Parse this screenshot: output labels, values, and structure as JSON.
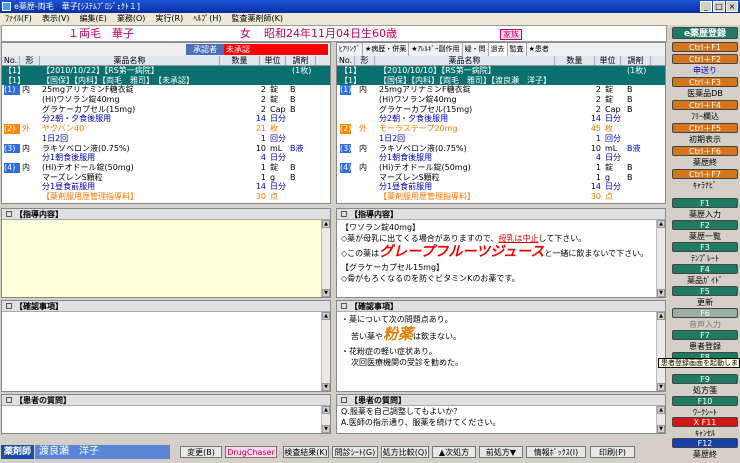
{
  "window": {
    "title": "e薬歴-両毛　華子[ｼｽﾃﾑﾌﾟﾛｼﾞｪｸﾄ１]"
  },
  "menu": [
    "ﾌｧｲﾙ(F)",
    "表示(V)",
    "編集(E)",
    "業務(O)",
    "実行(R)",
    "ﾍﾙﾌﾟ(H)",
    "監査薬剤師(K)"
  ],
  "patient": {
    "name": "１両毛　華子",
    "sex": "女",
    "birth": "昭和24年11月04日生",
    "age": "60歳",
    "badge": "家族"
  },
  "left": {
    "approver_label": "承認者",
    "approver_value": "未承認",
    "headers": [
      "No.",
      "形",
      "薬品名称",
      "数量",
      "単位",
      "調剤"
    ],
    "rows": [
      {
        "grp": true,
        "no": "【1】",
        "name": "【2010/10/22】【RS第一病院】",
        "adj": "(1枚)"
      },
      {
        "grp": true,
        "no": "【1】",
        "name": "【国保】【内科】【両毛　雅司】　【未承認】"
      },
      {
        "no": "(1)",
        "f": "内",
        "name": "25mgアリナミンF糖衣錠",
        "qty": "2",
        "unit": "錠",
        "adj": "B"
      },
      {
        "name": "(Hi)ワソラン錠40mg",
        "qty": "2",
        "unit": "錠",
        "adj": "B"
      },
      {
        "name": "グラケーカプセル(15mg)",
        "qty": "2",
        "unit": "Cap",
        "adj": "B"
      },
      {
        "name": "分2朝・夕食後服用",
        "qty": "14",
        "unit": "日分",
        "cls": "blue"
      },
      {
        "no": "(2)",
        "f": "外",
        "name": "ヤクバン40",
        "qty": "21",
        "unit": "枚",
        "cls": "orange"
      },
      {
        "name": "1日2回",
        "qty": "1",
        "unit": "回分",
        "cls": "blue"
      },
      {
        "no": "(3)",
        "f": "内",
        "name": "ラキソベロン液(0.75%)",
        "qty": "10",
        "unit": "mL",
        "adj": "B液"
      },
      {
        "name": "分1朝食後服用",
        "qty": "4",
        "unit": "日分",
        "cls": "blue"
      },
      {
        "no": "(4)",
        "f": "内",
        "name": "(Hi)テオドール錠(50mg)",
        "qty": "1",
        "unit": "錠",
        "adj": "B"
      },
      {
        "name": "マーズレンS顆粒",
        "qty": "1",
        "unit": "g",
        "adj": "B"
      },
      {
        "name": "分1昼食前服用",
        "qty": "14",
        "unit": "日分",
        "cls": "blue"
      },
      {
        "name": "【薬剤服用歴管理指導料】",
        "qty": "30",
        "unit": "点",
        "cls": "orange"
      }
    ]
  },
  "right": {
    "tabs": [
      "ﾋｱﾘﾝｸﾞ",
      "★病歴・併薬",
      "★ｱﾚﾙｷﾞｰ副作用",
      "疑・問",
      "過去",
      "監査",
      "★患者"
    ],
    "rows": [
      {
        "grp": true,
        "no": "【1】",
        "name": "【2010/10/10】【RS第一病院】",
        "adj": "(1枚)"
      },
      {
        "grp": true,
        "no": "【1】",
        "name": "【国保】【内科】【両毛　雅司】【渡良瀬　洋子】"
      },
      {
        "no": "(1)",
        "f": "内",
        "name": "25mgアリナミンF糖衣錠",
        "qty": "2",
        "unit": "錠",
        "adj": "B"
      },
      {
        "name": "(Hi)ワソラン錠40mg",
        "qty": "2",
        "unit": "錠",
        "adj": "B"
      },
      {
        "name": "グラケーカプセル(15mg)",
        "qty": "2",
        "unit": "Cap",
        "adj": "B"
      },
      {
        "name": "分2朝・夕食後服用",
        "qty": "14",
        "unit": "日分",
        "cls": "blue"
      },
      {
        "no": "(2)",
        "f": "外",
        "name": "モーラステープ20mg",
        "qty": "45",
        "unit": "枚",
        "cls": "orange"
      },
      {
        "name": "1日2回",
        "qty": "1",
        "unit": "回分",
        "cls": "blue"
      },
      {
        "no": "(3)",
        "f": "内",
        "name": "ラキソベロン液(0.75%)",
        "qty": "10",
        "unit": "mL",
        "adj": "B液"
      },
      {
        "name": "分1朝食後服用",
        "qty": "4",
        "unit": "日分",
        "cls": "blue"
      },
      {
        "no": "(4)",
        "f": "内",
        "name": "(Hi)テオドール錠(50mg)",
        "qty": "1",
        "unit": "錠",
        "adj": "B"
      },
      {
        "name": "マーズレンS顆粒",
        "qty": "1",
        "unit": "g",
        "adj": "B"
      },
      {
        "name": "分1昼食前服用",
        "qty": "14",
        "unit": "日分",
        "cls": "blue"
      },
      {
        "name": "【薬剤服用歴管理指導料】",
        "qty": "30",
        "unit": "点",
        "cls": "orange"
      }
    ]
  },
  "sections": {
    "guidance": "【指導内容】",
    "confirm": "【確認事項】",
    "question": "【患者の質問】"
  },
  "guidance_text": {
    "l1": "【ワソラン錠40mg】",
    "l2a": "◇薬が母乳に出てくる場合がありますので、",
    "l2b": "授乳は中止",
    "l2c": "して下さい。",
    "l3a": "◇この薬は",
    "l3b": "グレープフルーツジュース",
    "l3c": "と一緒に飲まないで下さい。",
    "l4": "【グラケーカプセル15mg】",
    "l5": "◇骨がもろくなるのを防ぐビタミンKのお薬です。"
  },
  "confirm_text": {
    "l1": "・薬について次の問題点あり。",
    "l2a": "苦い薬や",
    "l2b": "粉薬",
    "l2c": "は飲まない。",
    "l3": "・花粉症の軽い症状あり。",
    "l4": "次回医療機関の受診を勧めた。"
  },
  "question_text": {
    "l1": "Q.服薬を自己調整してもよいか？",
    "l2": "A.医師の指示通り、服薬を続けてください。"
  },
  "sidebar": {
    "title": "e薬歴登録",
    "fkeys": [
      "Ctrl＋F1",
      "Ctrl＋F2",
      "Ctrl＋F3",
      "Ctrl＋F4",
      "Ctrl＋F5",
      "Ctrl＋F6",
      "Ctrl＋F7"
    ],
    "flabels": [
      "申送り",
      "医薬品DB",
      "ﾌﾘｰ欄込",
      "初期表示",
      "薬歴終",
      "ｷｬﾗﾅﾋﾞ"
    ],
    "keys": [
      "F1",
      "F2",
      "F3",
      "F4",
      "F5",
      "F6",
      "F7",
      "F8",
      "F9",
      "F10",
      "X F11",
      "F12"
    ],
    "klabels": [
      "薬歴入力",
      "薬歴一覧",
      "ﾃﾝﾌﾟﾚｰﾄ",
      "薬品ｶﾞｲﾄﾞ",
      "更新",
      "音声入力",
      "患者登録",
      "",
      "処方箋",
      "ﾜｰｸｼｰﾄ",
      "ｷｬﾝｾﾙ",
      "薬歴終"
    ],
    "tooltip": "患者登録画面を起動します。"
  },
  "bottom": {
    "pharmacist_label": "薬剤師",
    "pharmacist_name": "渡良瀬　洋子",
    "buttons": [
      "変更(B)",
      "DrugChaser",
      "検査結果(K)",
      "問診ｼｰﾄ(G)",
      "処方比較(Q)",
      "▲次処方",
      "前処方▼",
      "情報ﾎﾞｯｸｽ(I)",
      "印刷(P)"
    ]
  },
  "colors": {
    "accent": "#0a6f6f",
    "title": "#0a2fa0",
    "patient": "#c0005a"
  }
}
